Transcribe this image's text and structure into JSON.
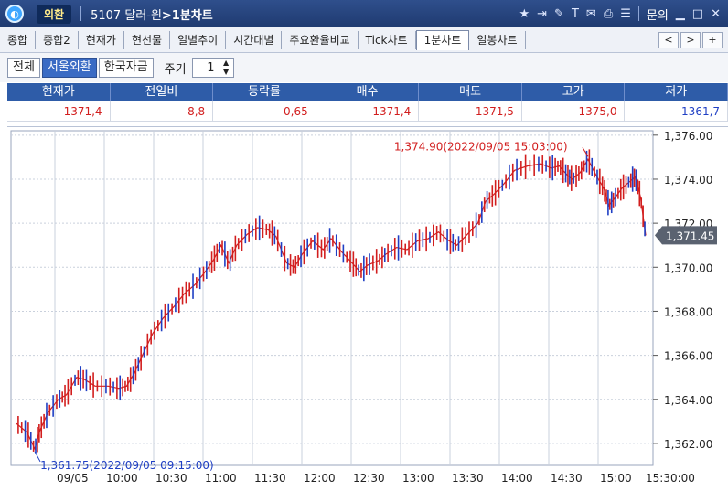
{
  "titlebar": {
    "brand": "외환",
    "code": "5107",
    "name": "달러-원",
    "view": ">1분차트",
    "help": "문의",
    "icons": [
      "star-icon",
      "export-icon",
      "link-icon",
      "font-icon",
      "chat-icon",
      "print-icon",
      "list-icon"
    ],
    "window_controls": [
      "minimize-icon",
      "maximize-icon",
      "close-icon"
    ]
  },
  "tabs": [
    {
      "label": "종합"
    },
    {
      "label": "종합2"
    },
    {
      "label": "현재가"
    },
    {
      "label": "현선물"
    },
    {
      "label": "일별추이"
    },
    {
      "label": "시간대별"
    },
    {
      "label": "주요환율비교"
    },
    {
      "label": "Tick차트"
    },
    {
      "label": "1분차트",
      "active": true
    },
    {
      "label": "일봉차트"
    }
  ],
  "tab_nav": [
    "<",
    ">",
    "+"
  ],
  "toolbar": {
    "segments": [
      "전체",
      "서울외환",
      "한국자금"
    ],
    "selected": "서울외환",
    "period_label": "주기",
    "period_value": "1"
  },
  "quote": {
    "headers": [
      "현재가",
      "전일비",
      "등락률",
      "매수",
      "매도",
      "고가",
      "저가"
    ],
    "values": [
      "1371.4",
      "8.8",
      "0.65",
      "1371.4",
      "1371.5",
      "1375.0",
      "1361.7"
    ],
    "colors": [
      "#d21e1e",
      "#d21e1e",
      "#d21e1e",
      "#d21e1e",
      "#d21e1e",
      "#d21e1e",
      "#1f3fc4"
    ]
  },
  "chart_data": {
    "type": "line",
    "x_ticks": [
      "09/05",
      "10:00",
      "10:30",
      "11:00",
      "11:30",
      "12:00",
      "12:30",
      "13:00",
      "13:30",
      "14:00",
      "14:30",
      "15:00",
      "15:30:00"
    ],
    "y_ticks": [
      "1,376.00",
      "1,374.00",
      "1,372.00",
      "1,370.00",
      "1,368.00",
      "1,366.00",
      "1,364.00",
      "1,362.00"
    ],
    "ylim": [
      1361.0,
      1376.2
    ],
    "x_minutes_range": [
      0,
      390
    ],
    "series": [
      {
        "points": [
          [
            0,
            1362.9
          ],
          [
            8,
            1362.5
          ],
          [
            14,
            1361.75
          ],
          [
            18,
            1362.6
          ],
          [
            24,
            1363.4
          ],
          [
            32,
            1364.0
          ],
          [
            38,
            1364.2
          ],
          [
            46,
            1365.0
          ],
          [
            52,
            1364.9
          ],
          [
            60,
            1364.6
          ],
          [
            70,
            1364.6
          ],
          [
            78,
            1364.5
          ],
          [
            84,
            1364.6
          ],
          [
            90,
            1365.2
          ],
          [
            96,
            1366.0
          ],
          [
            104,
            1367.0
          ],
          [
            112,
            1367.7
          ],
          [
            120,
            1368.2
          ],
          [
            128,
            1368.8
          ],
          [
            136,
            1369.2
          ],
          [
            144,
            1369.8
          ],
          [
            150,
            1370.3
          ],
          [
            156,
            1371.0
          ],
          [
            162,
            1370.2
          ],
          [
            168,
            1371.0
          ],
          [
            176,
            1371.5
          ],
          [
            184,
            1371.8
          ],
          [
            192,
            1371.7
          ],
          [
            198,
            1371.4
          ],
          [
            206,
            1370.2
          ],
          [
            212,
            1370.0
          ],
          [
            218,
            1370.6
          ],
          [
            226,
            1371.2
          ],
          [
            234,
            1370.8
          ],
          [
            240,
            1371.3
          ],
          [
            248,
            1370.7
          ],
          [
            256,
            1370.2
          ],
          [
            262,
            1369.8
          ],
          [
            268,
            1370.1
          ],
          [
            276,
            1370.3
          ],
          [
            282,
            1370.6
          ],
          [
            290,
            1370.9
          ],
          [
            298,
            1370.8
          ],
          [
            306,
            1371.2
          ],
          [
            314,
            1371.3
          ],
          [
            322,
            1371.6
          ],
          [
            330,
            1371.2
          ],
          [
            336,
            1371.0
          ],
          [
            344,
            1371.5
          ],
          [
            352,
            1372.0
          ],
          [
            358,
            1373.0
          ],
          [
            364,
            1373.3
          ],
          [
            372,
            1373.8
          ],
          [
            380,
            1374.4
          ],
          [
            390,
            1374.6
          ],
          [
            400,
            1374.7
          ],
          [
            408,
            1374.5
          ],
          [
            414,
            1374.6
          ],
          [
            420,
            1374.2
          ],
          [
            424,
            1374.0
          ],
          [
            430,
            1374.3
          ],
          [
            436,
            1374.9
          ],
          [
            442,
            1374.2
          ],
          [
            448,
            1373.6
          ],
          [
            452,
            1372.8
          ],
          [
            456,
            1373.1
          ],
          [
            462,
            1373.6
          ],
          [
            468,
            1373.9
          ],
          [
            472,
            1374.1
          ],
          [
            476,
            1373.2
          ],
          [
            480,
            1371.45
          ]
        ]
      }
    ],
    "annotations": [
      {
        "text": "1,374.90(2022/09/05 15:03:00)",
        "color": "#d21e1e"
      },
      {
        "text": "1,361.75(2022/09/05 09:15:00)",
        "color": "#1f3fc4"
      },
      {
        "text": "1,371.45",
        "color": "#ffffff"
      }
    ]
  }
}
